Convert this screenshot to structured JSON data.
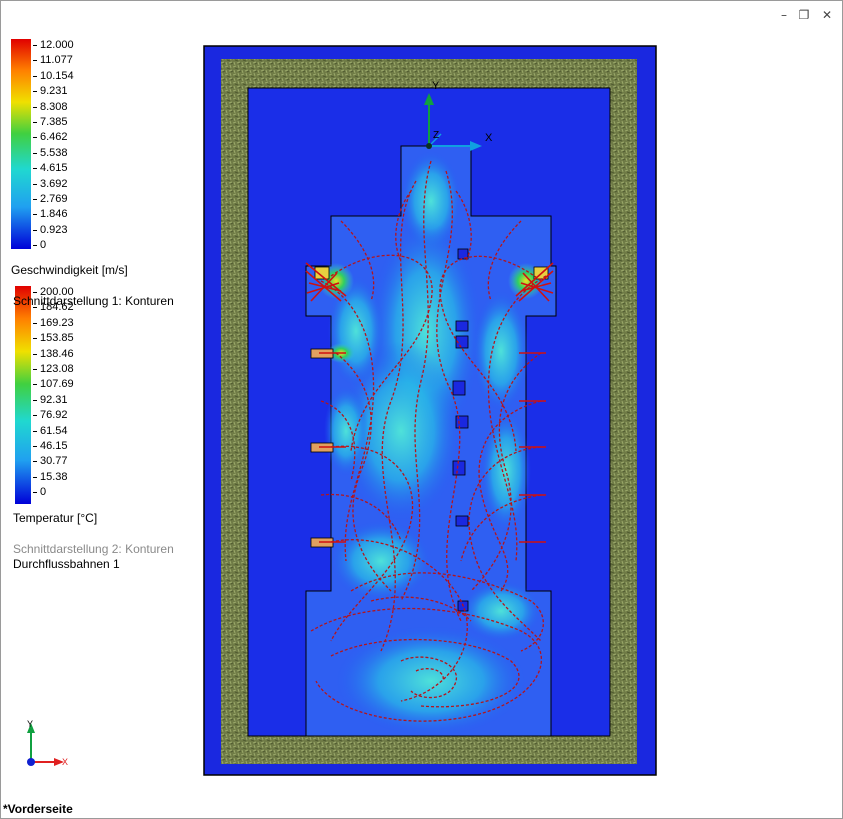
{
  "window": {
    "minimize_icon": "minimize-icon",
    "restore_icon": "restore-icon",
    "close_icon": "close-icon"
  },
  "legend_velocity": {
    "title": "Geschwindigkeit [m/s]",
    "ticks": [
      "12.000",
      "11.077",
      "10.154",
      "9.231",
      "8.308",
      "7.385",
      "6.462",
      "5.538",
      "4.615",
      "3.692",
      "2.769",
      "1.846",
      "0.923",
      "0"
    ]
  },
  "legend_temperature": {
    "title": "Temperatur [°C]",
    "ticks": [
      "200.00",
      "184.62",
      "169.23",
      "153.85",
      "138.46",
      "123.08",
      "107.69",
      "92.31",
      "76.92",
      "61.54",
      "46.15",
      "30.77",
      "15.38",
      "0"
    ]
  },
  "section1_label": "Schnittdarstellung 1: Konturen",
  "section2_label": "Schnittdarstellung 2: Konturen",
  "flow_label": "Durchflussbahnen 1",
  "axes": {
    "x": "X",
    "y": "Y",
    "z": "Z"
  },
  "view_name": "*Vorderseite",
  "colors": {
    "cold": "#1414d8",
    "hot": "#e00000",
    "insulation": "#6e7a44",
    "streamline": "#b4141c"
  }
}
